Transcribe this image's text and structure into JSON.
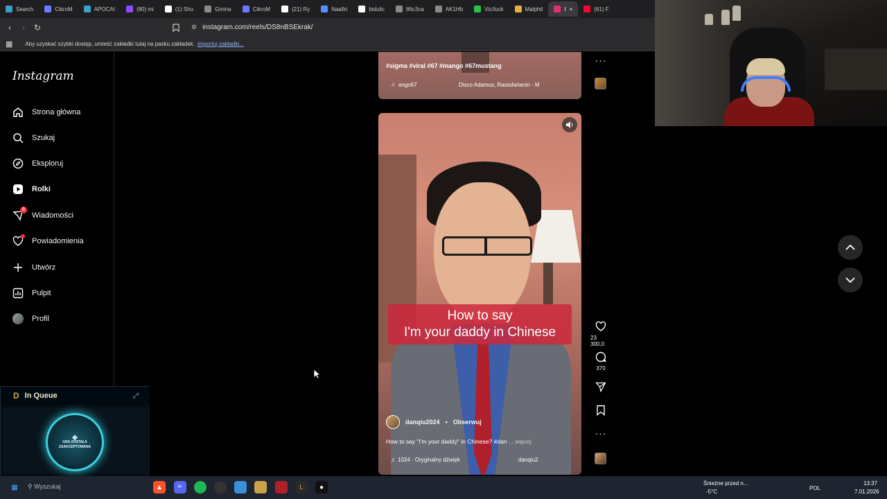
{
  "browser": {
    "tabs": [
      {
        "label": "Search",
        "color": "#3aa0c8"
      },
      {
        "label": "CikroM",
        "color": "#6b7bff"
      },
      {
        "label": "APOCAI",
        "color": "#3aa0c8"
      },
      {
        "label": "(80) mi",
        "color": "#9146ff"
      },
      {
        "label": "(1) Sho",
        "color": "#ffffff"
      },
      {
        "label": "Gmina",
        "color": "#8a8a8a"
      },
      {
        "label": "CikroM",
        "color": "#6b7bff"
      },
      {
        "label": "(21) Ry",
        "color": "#ffffff"
      },
      {
        "label": "Naafiri",
        "color": "#5b8cff"
      },
      {
        "label": "bidulic",
        "color": "#ffffff"
      },
      {
        "label": "86c3ca",
        "color": "#8a8a8a"
      },
      {
        "label": "AK1Hb",
        "color": "#8a8a8a"
      },
      {
        "label": "Vic/luck",
        "color": "#27c24c"
      },
      {
        "label": "Malphit",
        "color": "#e0b040"
      },
      {
        "label": "I",
        "color": "#e1306c",
        "active": true
      },
      {
        "label": "(61) F",
        "color": "#ff0033"
      }
    ],
    "url": "instagram.com/reels/DS8nBSEkrak/",
    "bookmarks_text": "Aby uzyskać szybki dostęp, umieść zakładki tutaj na pasku zakładek.",
    "bookmarks_link": "Importuj zakładki..."
  },
  "sidebar": {
    "logo": "Instagram",
    "items": [
      {
        "label": "Strona główna",
        "icon": "home-icon"
      },
      {
        "label": "Szukaj",
        "icon": "search-icon"
      },
      {
        "label": "Eksploruj",
        "icon": "compass-icon"
      },
      {
        "label": "Rolki",
        "icon": "reels-icon",
        "active": true
      },
      {
        "label": "Wiadomości",
        "icon": "messenger-icon",
        "badge": "8"
      },
      {
        "label": "Powiadomienia",
        "icon": "heart-icon",
        "dot": true
      },
      {
        "label": "Utwórz",
        "icon": "plus-icon"
      },
      {
        "label": "Pulpit",
        "icon": "dashboard-icon"
      },
      {
        "label": "Profil",
        "icon": "profile-avatar"
      }
    ]
  },
  "prev_reel": {
    "hashtags": "#sigma #viral #67 #mango #67mustang",
    "audio_user": "ango67",
    "audio_track": "Disco Adamus, Rastafarianin - M"
  },
  "reel": {
    "caption_line1": "How to say",
    "caption_line2": "I'm your daddy in Chinese",
    "username": "danqiu2024",
    "follow": "Obserwuj",
    "description": "How to say \"I'm your daddy\" in Chinese? #dan",
    "more": "... więcej",
    "audio": "1024 · Oryginalny dźwięk",
    "audio_user": "danqiu2",
    "likes": "23 300,0",
    "comments": "370"
  },
  "queue": {
    "title": "In Queue",
    "status_line1": "GRA ZOSTAŁA",
    "status_line2": "ZAAKCEPTOWANA"
  },
  "taskbar": {
    "search": "Wyszukaj",
    "weather_line1": "Śnieżne przed n...",
    "weather_line2": "-5°C",
    "lang": "POL",
    "time": "13:37",
    "date": "7.01.2026",
    "discord_badge": "9+"
  }
}
